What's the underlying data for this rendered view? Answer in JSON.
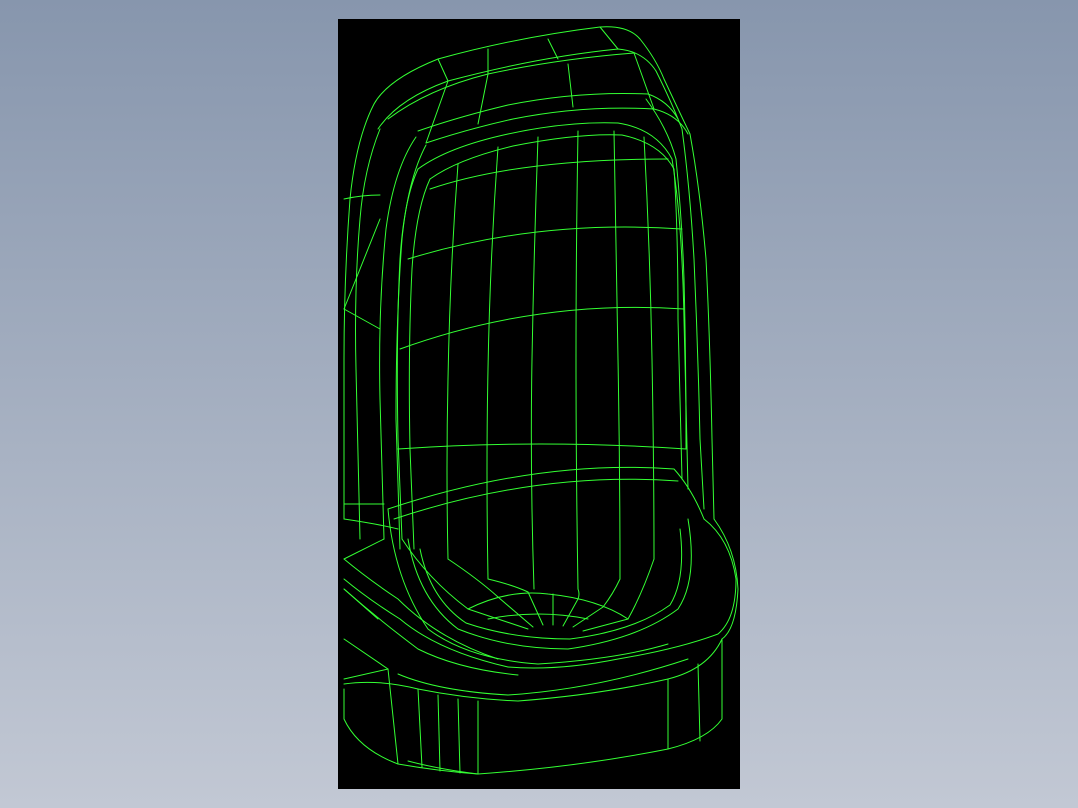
{
  "viewport": {
    "background_top": "#8796ad",
    "background_bottom": "#c2c8d4"
  },
  "canvas": {
    "background": "#000000",
    "model": "seat-wireframe",
    "wire_color": "#33ff33"
  }
}
